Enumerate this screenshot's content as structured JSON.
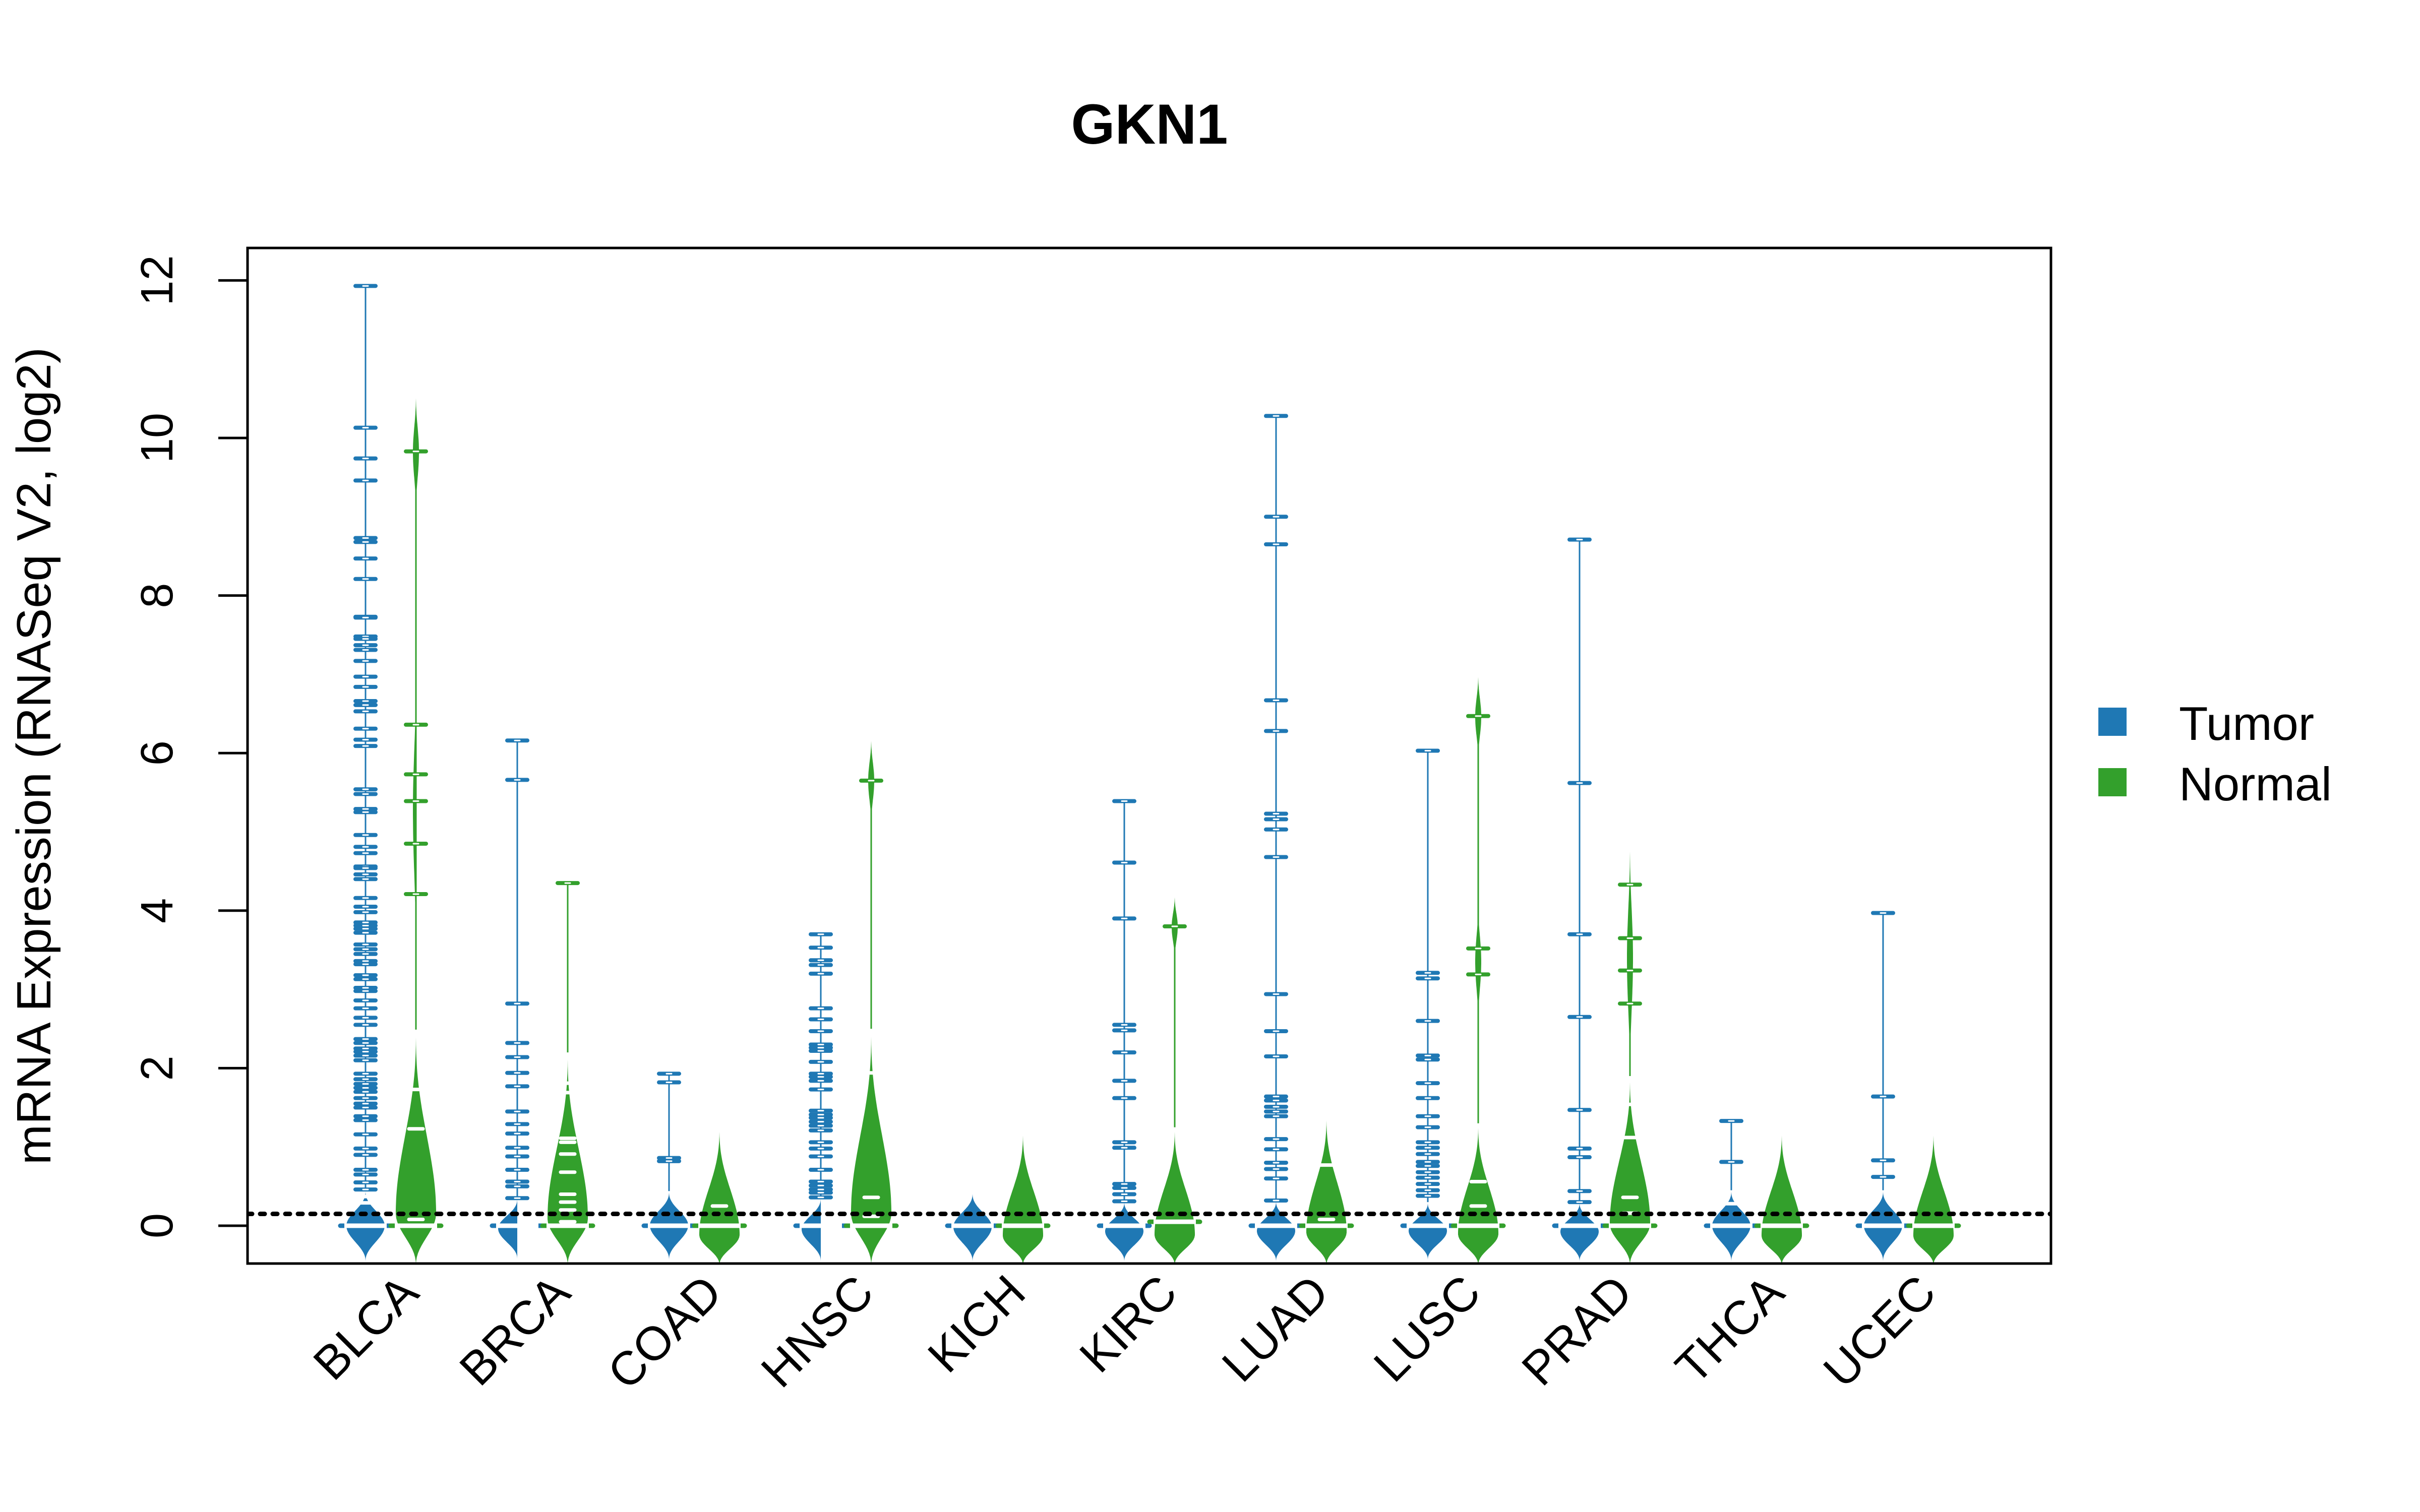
{
  "chart_data": {
    "type": "beanplot",
    "title": "GKN1",
    "xlabel": "",
    "ylabel": "mRNA Expression (RNASeq V2, log2)",
    "ylim": [
      -0.47,
      12.45
    ],
    "yticks": [
      0,
      2,
      4,
      6,
      8,
      10,
      12
    ],
    "grid": false,
    "legend": {
      "position": "right",
      "entries": [
        {
          "name": "Tumor",
          "color": "#1F78B4"
        },
        {
          "name": "Normal",
          "color": "#33A02C"
        }
      ]
    },
    "overall_mean_line": 0.15,
    "categories": [
      "BLCA",
      "BRCA",
      "COAD",
      "HNSC",
      "KICH",
      "KIRC",
      "LUAD",
      "LUSC",
      "PRAD",
      "THCA",
      "UCEC"
    ],
    "series": [
      {
        "name": "Tumor",
        "color": "#1F78B4",
        "groups": [
          {
            "category": "BLCA",
            "mean": 0.0,
            "bulk_range": [
              -0.45,
              0.45
            ],
            "points": [
              11.93,
              10.13,
              9.74,
              9.46,
              8.73,
              8.68,
              8.47,
              8.21,
              7.73,
              7.72,
              7.48,
              7.45,
              7.37,
              7.31,
              7.17,
              6.97,
              6.84,
              6.66,
              6.61,
              6.53,
              6.31,
              6.17,
              6.09,
              5.54,
              5.48,
              5.29,
              5.25,
              4.96,
              4.81,
              4.73,
              4.56,
              4.54,
              4.46,
              4.4,
              4.16,
              4.05,
              3.98,
              3.85,
              3.81,
              3.77,
              3.72,
              3.57,
              3.51,
              3.45,
              3.36,
              3.32,
              3.18,
              3.13,
              3.02,
              2.98,
              2.86,
              2.76,
              2.64,
              2.55,
              2.37,
              2.32,
              2.25,
              2.21,
              2.16,
              2.1,
              1.93,
              1.86,
              1.8,
              1.75,
              1.7,
              1.62,
              1.55,
              1.5,
              1.39,
              1.34,
              1.16,
              0.98,
              0.9,
              0.71,
              0.65,
              0.55,
              0.46,
              0.37,
              0.29
            ]
          },
          {
            "category": "BRCA",
            "mean": 0.0,
            "bulk_range": [
              -0.42,
              0.35
            ],
            "points": [
              6.16,
              5.66,
              2.82,
              2.32,
              2.14,
              1.94,
              1.77,
              1.45,
              1.29,
              1.17,
              0.99,
              0.88,
              0.71,
              0.56,
              0.5,
              0.35
            ]
          },
          {
            "category": "COAD",
            "mean": 0.0,
            "bulk_range": [
              -0.43,
              0.44
            ],
            "points": [
              1.93,
              1.82,
              0.86,
              0.82
            ]
          },
          {
            "category": "HNSC",
            "mean": 0.0,
            "bulk_range": [
              -0.45,
              0.36
            ],
            "points": [
              3.7,
              3.53,
              3.37,
              3.31,
              3.2,
              2.76,
              2.62,
              2.47,
              2.3,
              2.26,
              2.22,
              2.08,
              1.93,
              1.89,
              1.84,
              1.73,
              1.46,
              1.41,
              1.37,
              1.32,
              1.27,
              1.21,
              1.06,
              0.98,
              0.88,
              0.71,
              0.56,
              0.51,
              0.46,
              0.42,
              0.36
            ]
          },
          {
            "category": "KICH",
            "mean": 0.0,
            "bulk_range": [
              -0.45,
              0.42
            ],
            "points": []
          },
          {
            "category": "KIRC",
            "mean": 0.0,
            "bulk_range": [
              -0.45,
              0.31
            ],
            "points": [
              5.39,
              4.61,
              3.9,
              2.55,
              2.48,
              2.2,
              1.84,
              1.62,
              1.06,
              0.99,
              0.53,
              0.48,
              0.4,
              0.31
            ]
          },
          {
            "category": "LUAD",
            "mean": 0.0,
            "bulk_range": [
              -0.45,
              0.32
            ],
            "points": [
              10.28,
              9.0,
              8.65,
              6.67,
              6.28,
              5.23,
              5.16,
              5.03,
              4.68,
              2.94,
              2.47,
              2.15,
              1.64,
              1.59,
              1.51,
              1.45,
              1.39,
              1.1,
              0.97,
              0.8,
              0.72,
              0.6,
              0.32
            ]
          },
          {
            "category": "LUSC",
            "mean": 0.0,
            "bulk_range": [
              -0.43,
              0.3
            ],
            "points": [
              6.03,
              3.21,
              3.14,
              2.6,
              2.16,
              2.11,
              1.81,
              1.62,
              1.39,
              1.25,
              1.06,
              0.99,
              0.91,
              0.81,
              0.76,
              0.68,
              0.61,
              0.53,
              0.45,
              0.38
            ]
          },
          {
            "category": "PRAD",
            "mean": 0.0,
            "bulk_range": [
              -0.45,
              0.3
            ],
            "points": [
              8.71,
              5.62,
              3.7,
              2.65,
              1.47,
              0.98,
              0.87,
              0.44,
              0.3
            ]
          },
          {
            "category": "THCA",
            "mean": 0.0,
            "bulk_range": [
              -0.45,
              0.45
            ],
            "points": [
              1.33,
              0.81,
              0.28
            ]
          },
          {
            "category": "UCEC",
            "mean": 0.0,
            "bulk_range": [
              -0.45,
              0.45
            ],
            "points": [
              3.97,
              1.64,
              0.83,
              0.62
            ]
          }
        ]
      },
      {
        "name": "Normal",
        "color": "#33A02C",
        "groups": [
          {
            "category": "BLCA",
            "mean": 0.0,
            "bulk_range": [
              -0.5,
              2.49
            ],
            "points": [
              9.83,
              6.36,
              5.73,
              5.39,
              4.85,
              4.21,
              1.73,
              1.23,
              0.08
            ],
            "sub_beans": [
              [
                9.07,
                10.58
              ],
              [
                3.45,
                7.11
              ]
            ]
          },
          {
            "category": "BRCA",
            "mean": 0.0,
            "bulk_range": [
              -0.5,
              2.2
            ],
            "points": [
              4.35,
              1.81,
              1.69,
              1.11,
              1.06,
              0.91,
              0.68,
              0.4,
              0.3,
              0.2,
              0.05
            ]
          },
          {
            "category": "COAD",
            "mean": 0.0,
            "bulk_range": [
              -0.5,
              1.25
            ],
            "points": [
              0.25
            ]
          },
          {
            "category": "HNSC",
            "mean": 0.0,
            "bulk_range": [
              -0.5,
              2.5
            ],
            "points": [
              5.65,
              1.94,
              0.36,
              0.12
            ],
            "sub_beans": [
              [
                5.09,
                6.21
              ]
            ]
          },
          {
            "category": "KICH",
            "mean": 0.0,
            "bulk_range": [
              -0.5,
              1.2
            ],
            "points": []
          },
          {
            "category": "KIRC",
            "mean": 0.05,
            "bulk_range": [
              -0.5,
              1.25
            ],
            "points": [
              3.8
            ],
            "sub_beans": [
              [
                3.38,
                4.21
              ]
            ]
          },
          {
            "category": "LUAD",
            "mean": 0.0,
            "bulk_range": [
              -0.5,
              1.4
            ],
            "points": [
              0.77,
              0.08
            ]
          },
          {
            "category": "LUSC",
            "mean": 0.0,
            "bulk_range": [
              -0.5,
              1.3
            ],
            "points": [
              6.47,
              3.52,
              3.19,
              0.56,
              0.25
            ],
            "sub_beans": [
              [
                5.91,
                7.02
              ],
              [
                2.58,
                4.13
              ]
            ]
          },
          {
            "category": "PRAD",
            "mean": 0.0,
            "bulk_range": [
              -0.5,
              1.9
            ],
            "points": [
              4.33,
              3.65,
              3.24,
              2.82,
              1.54,
              1.12,
              0.36,
              0.16
            ],
            "sub_beans": [
              [
                1.9,
                4.9
              ]
            ]
          },
          {
            "category": "THCA",
            "mean": 0.0,
            "bulk_range": [
              -0.5,
              1.2
            ],
            "points": []
          },
          {
            "category": "UCEC",
            "mean": 0.0,
            "bulk_range": [
              -0.5,
              1.2
            ],
            "points": []
          }
        ]
      }
    ]
  }
}
